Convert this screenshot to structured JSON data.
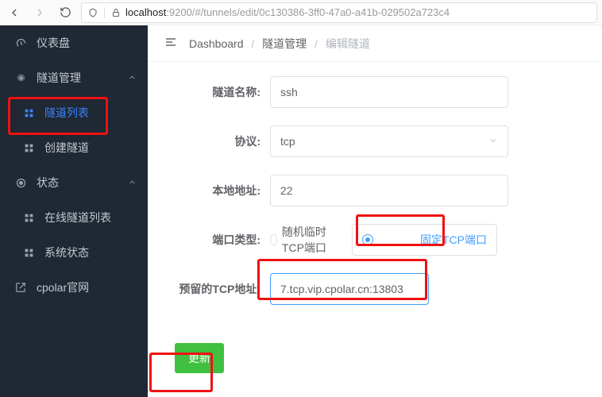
{
  "browser": {
    "url_host": "localhost",
    "url_rest": ":9200/#/tunnels/edit/0c130386-3ff0-47a0-a41b-029502a723c4"
  },
  "sidebar": {
    "items": [
      {
        "label": "仪表盘"
      },
      {
        "label": "隧道管理"
      },
      {
        "label": "隧道列表"
      },
      {
        "label": "创建隧道"
      },
      {
        "label": "状态"
      },
      {
        "label": "在线隧道列表"
      },
      {
        "label": "系统状态"
      },
      {
        "label": "cpolar官网"
      }
    ]
  },
  "breadcrumb": {
    "a": "Dashboard",
    "b": "隧道管理",
    "c": "编辑隧道"
  },
  "form": {
    "labels": {
      "name": "隧道名称:",
      "proto": "协议:",
      "local": "本地地址:",
      "port_type": "端口类型:",
      "reserved": "预留的TCP地址:"
    },
    "name_value": "ssh",
    "proto_value": "tcp",
    "local_value": "22",
    "port_type_random": "随机临时TCP端口",
    "port_type_fixed": "固定TCP端口",
    "reserved_value": "7.tcp.vip.cpolar.cn:13803",
    "submit_label": "更新"
  }
}
